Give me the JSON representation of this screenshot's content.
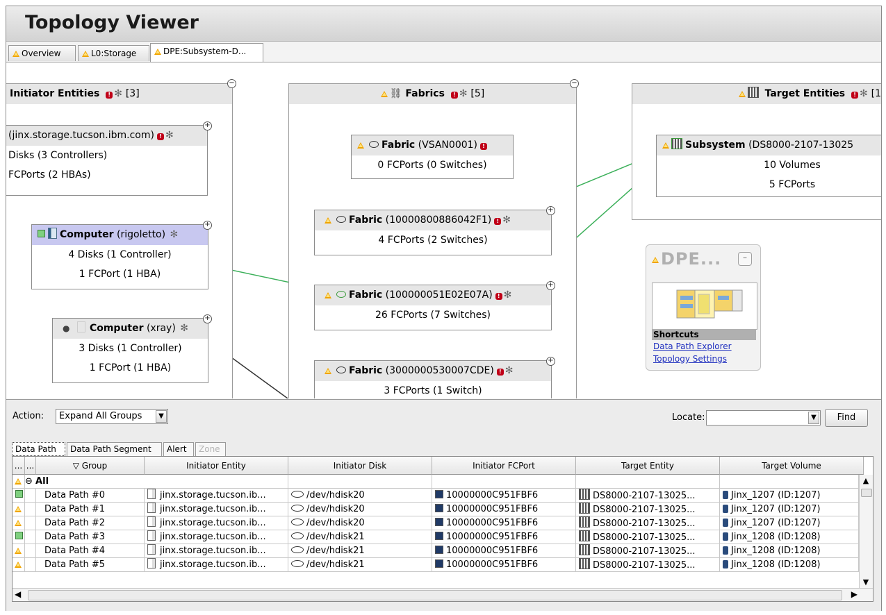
{
  "app": {
    "title": "Topology Viewer"
  },
  "tabs": [
    {
      "label": "Overview"
    },
    {
      "label": "L0:Storage"
    },
    {
      "label": "DPE:Subsystem-D..."
    }
  ],
  "groups": {
    "initiator": {
      "title": "Initiator Entities",
      "count": "[3]"
    },
    "fabrics": {
      "title": "Fabrics",
      "count": "[5]"
    },
    "target": {
      "title": "Target Entities",
      "count": "[1"
    }
  },
  "nodes": {
    "jinx": {
      "name": "(jinx.storage.tucson.ibm.com)",
      "line1": "Disks (3 Controllers)",
      "line2": "FCPorts (2 HBAs)"
    },
    "rigoletto": {
      "type": "Computer",
      "name": "(rigoletto)",
      "line1": "4 Disks (1 Controller)",
      "line2": "1 FCPort (1 HBA)"
    },
    "xray": {
      "type": "Computer",
      "name": "(xray)",
      "line1": "3 Disks (1 Controller)",
      "line2": "1 FCPort (1 HBA)"
    },
    "fabric1": {
      "type": "Fabric",
      "name": "(VSAN0001)",
      "line1": "0 FCPorts (0 Switches)"
    },
    "fabric2": {
      "type": "Fabric",
      "name": "(10000800886042F1)",
      "line1": "4 FCPorts (2 Switches)"
    },
    "fabric3": {
      "type": "Fabric",
      "name": "(100000051E02E07A)",
      "line1": "26 FCPorts (7 Switches)"
    },
    "fabric4": {
      "type": "Fabric",
      "name": "(3000000530007CDE)",
      "line1": "3 FCPorts (1 Switch)"
    },
    "subsystem": {
      "type": "Subsystem",
      "name": "(DS8000-2107-13025",
      "line1": "10 Volumes",
      "line2": "5 FCPorts"
    }
  },
  "dpe_panel": {
    "title": "DPE...",
    "shortcuts_label": "Shortcuts",
    "link1": "Data Path Explorer",
    "link2": "Topology Settings"
  },
  "toolbar": {
    "action_label": "Action:",
    "action_value": "Expand All Groups",
    "locate_label": "Locate:",
    "locate_value": "",
    "find_label": "Find"
  },
  "bottom_tabs": [
    {
      "label": "Data Path"
    },
    {
      "label": "Data Path Segment"
    },
    {
      "label": "Alert"
    },
    {
      "label": "Zone"
    }
  ],
  "table": {
    "columns": [
      "...",
      "...",
      "Group",
      "Initiator Entity",
      "Initiator Disk",
      "Initiator FCPort",
      "Target Entity",
      "Target Volume"
    ],
    "all_label": "All",
    "rows": [
      {
        "status": "ok",
        "group": "Data Path #0",
        "entity": "jinx.storage.tucson.ib...",
        "disk": "/dev/hdisk20",
        "port": "10000000C951FBF6",
        "target": "DS8000-2107-13025...",
        "volume": "Jinx_1207 (ID:1207)"
      },
      {
        "status": "warn",
        "group": "Data Path #1",
        "entity": "jinx.storage.tucson.ib...",
        "disk": "/dev/hdisk20",
        "port": "10000000C951FBF6",
        "target": "DS8000-2107-13025...",
        "volume": "Jinx_1207 (ID:1207)"
      },
      {
        "status": "warn",
        "group": "Data Path #2",
        "entity": "jinx.storage.tucson.ib...",
        "disk": "/dev/hdisk20",
        "port": "10000000C951FBF6",
        "target": "DS8000-2107-13025...",
        "volume": "Jinx_1207 (ID:1207)"
      },
      {
        "status": "ok",
        "group": "Data Path #3",
        "entity": "jinx.storage.tucson.ib...",
        "disk": "/dev/hdisk21",
        "port": "10000000C951FBF6",
        "target": "DS8000-2107-13025...",
        "volume": "Jinx_1208 (ID:1208)"
      },
      {
        "status": "warn",
        "group": "Data Path #4",
        "entity": "jinx.storage.tucson.ib...",
        "disk": "/dev/hdisk21",
        "port": "10000000C951FBF6",
        "target": "DS8000-2107-13025...",
        "volume": "Jinx_1208 (ID:1208)"
      },
      {
        "status": "warn",
        "group": "Data Path #5",
        "entity": "jinx.storage.tucson.ib...",
        "disk": "/dev/hdisk21",
        "port": "10000000C951FBF6",
        "target": "DS8000-2107-13025...",
        "volume": "Jinx_1208 (ID:1208)"
      }
    ]
  },
  "colors": {
    "accent_link": "#1f2fbf",
    "status_ok": "#7fd07f",
    "status_warn": "#f0a400",
    "status_error": "#c00018",
    "connection_line": "#3cb05a"
  }
}
